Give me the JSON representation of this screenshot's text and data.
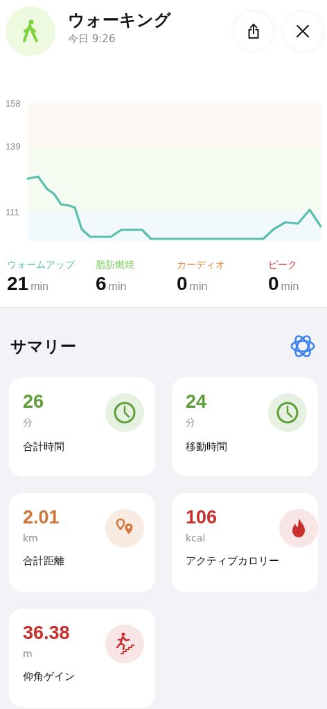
{
  "header": {
    "title": "ウォーキング",
    "subtitle": "今日 9:26"
  },
  "heart_rate": {
    "axis_labels": [
      "158",
      "139",
      "111"
    ]
  },
  "zones": [
    {
      "label": "ウォームアップ",
      "value": "21",
      "unit": "min",
      "color": "#5bbfae"
    },
    {
      "label": "脂肪燃焼",
      "value": "6",
      "unit": "min",
      "color": "#7ed05a"
    },
    {
      "label": "カーディオ",
      "value": "0",
      "unit": "min",
      "color": "#e8883a"
    },
    {
      "label": "ピーク",
      "value": "0",
      "unit": "min",
      "color": "#d43a3a"
    }
  ],
  "summary": {
    "title": "サマリー",
    "cards": [
      {
        "kind": "clock",
        "value": "26",
        "unit": "分",
        "label": "合計時間",
        "color": "#5f9e3a"
      },
      {
        "kind": "clock",
        "value": "24",
        "unit": "分",
        "label": "移動時間",
        "color": "#5f9e3a"
      },
      {
        "kind": "pins",
        "value": "2.01",
        "unit": "km",
        "label": "合計距離",
        "color": "#d0763a"
      },
      {
        "kind": "flame",
        "value": "106",
        "unit": "kcal",
        "label": "アクティブカロリー",
        "color": "#c8302e"
      },
      {
        "kind": "stairs",
        "value": "36.38",
        "unit": "m",
        "label": "仰角ゲイン",
        "color": "#c8302e"
      }
    ]
  }
}
